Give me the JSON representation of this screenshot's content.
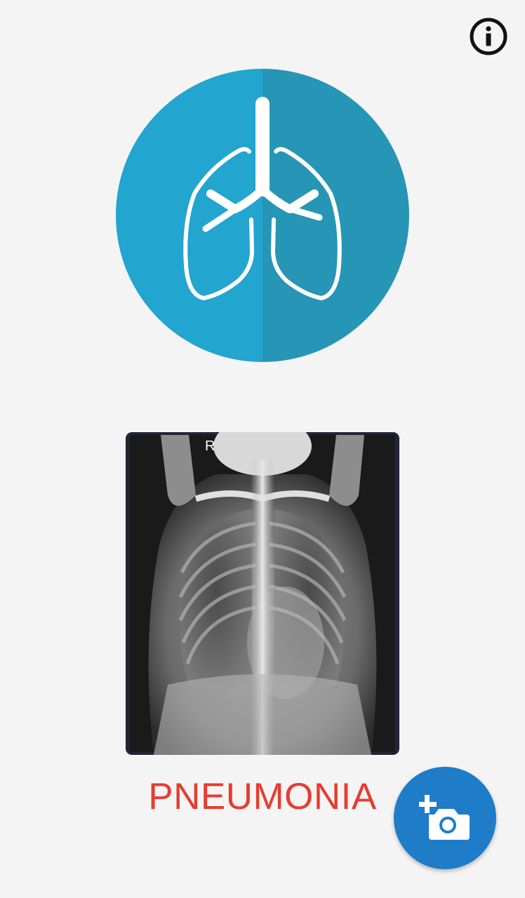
{
  "app": {
    "info_icon": "info-icon",
    "logo_icon": "lungs-icon",
    "xray_marker": "R",
    "result_label": "PNEUMONIA",
    "add_photo_icon": "add-camera-icon"
  },
  "colors": {
    "background": "#f4f4f4",
    "logo_light": "#22a5cf",
    "logo_dark": "#2795b5",
    "result_text": "#e53d31",
    "fab": "#1e7cc9",
    "frame": "#232338"
  }
}
